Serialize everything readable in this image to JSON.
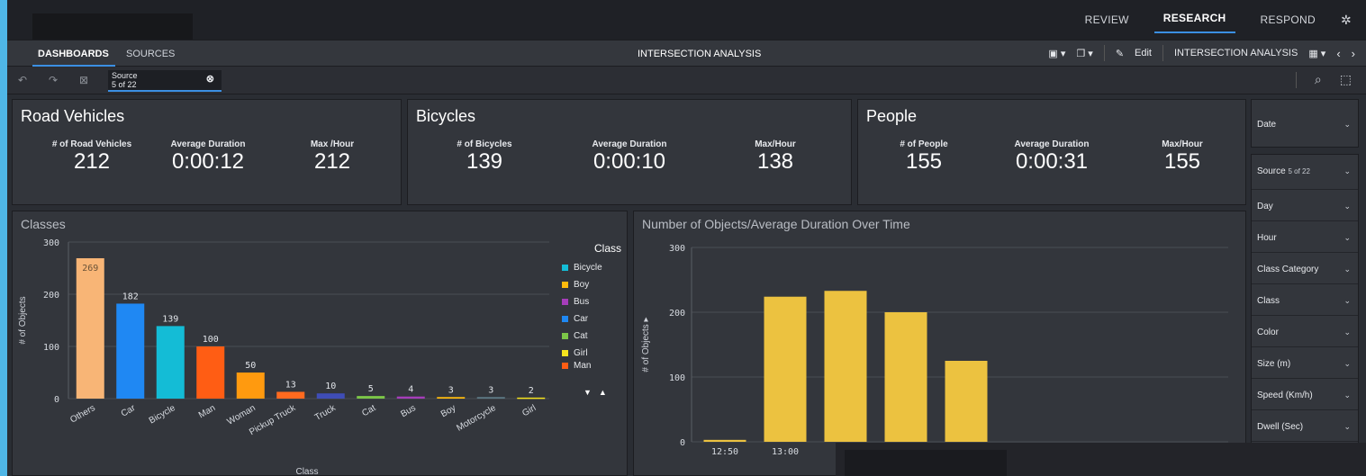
{
  "top_menu": {
    "review": "REVIEW",
    "research": "RESEARCH",
    "respond": "RESPOND",
    "gear_icon": "gear-icon"
  },
  "nav": {
    "dashboards": "DASHBOARDS",
    "sources": "SOURCES",
    "center_title": "INTERSECTION ANALYSIS",
    "edit": "Edit",
    "right_title": "INTERSECTION ANALYSIS"
  },
  "filter": {
    "source_label": "Source",
    "source_value": "5 of 22"
  },
  "kpis": [
    {
      "title": "Road Vehicles",
      "stats": [
        {
          "label": "# of Road Vehicles",
          "value": "212"
        },
        {
          "label": "Average Duration",
          "value": "0:00:12"
        },
        {
          "label": "Max /Hour",
          "value": "212"
        }
      ]
    },
    {
      "title": "Bicycles",
      "stats": [
        {
          "label": "# of Bicycles",
          "value": "139"
        },
        {
          "label": "Average Duration",
          "value": "0:00:10"
        },
        {
          "label": "Max/Hour",
          "value": "138"
        }
      ]
    },
    {
      "title": "People",
      "stats": [
        {
          "label": "# of People",
          "value": "155"
        },
        {
          "label": "Average Duration",
          "value": "0:00:31"
        },
        {
          "label": "Max/Hour",
          "value": "155"
        }
      ]
    }
  ],
  "chart_data": [
    {
      "type": "bar",
      "title": "Classes",
      "xlabel": "Class",
      "ylabel": "# of Objects",
      "ylim": [
        0,
        300
      ],
      "yticks": [
        "300",
        "200",
        "100",
        "0"
      ],
      "categories": [
        "Others",
        "Car",
        "Bicycle",
        "Man",
        "Woman",
        "Pickup Truck",
        "Truck",
        "Cat",
        "Bus",
        "Boy",
        "Motorcycle",
        "Girl"
      ],
      "values": [
        269,
        182,
        139,
        100,
        50,
        13,
        10,
        5,
        4,
        3,
        3,
        2
      ],
      "colors": [
        "#f8b576",
        "#1f88f3",
        "#14bcd6",
        "#ff5d14",
        "#ff9a0f",
        "#ff6a1f",
        "#3f4db6",
        "#7cc648",
        "#a63dba",
        "#ffbb0d",
        "#5d7a86",
        "#f6e41e"
      ],
      "legend_title": "Class",
      "legend": [
        {
          "name": "Bicycle",
          "color": "#14bcd6"
        },
        {
          "name": "Boy",
          "color": "#ffbb0d"
        },
        {
          "name": "Bus",
          "color": "#a63dba"
        },
        {
          "name": "Car",
          "color": "#1f88f3"
        },
        {
          "name": "Cat",
          "color": "#7cc648"
        },
        {
          "name": "Girl",
          "color": "#f6e41e"
        },
        {
          "name": "Man",
          "color": "#ff5d14"
        }
      ],
      "grid": true,
      "legend_position": "right"
    },
    {
      "type": "bar",
      "title": "Number of Objects/Average Duration Over Time",
      "ylabel": "# of Objects",
      "ylim": [
        0,
        300
      ],
      "yticks": [
        "300",
        "200",
        "100",
        "0"
      ],
      "categories": [
        "12:50",
        "13:00",
        "",
        "",
        ""
      ],
      "values": [
        3,
        224,
        233,
        200,
        125
      ],
      "color": "#ecc240",
      "grid": true
    }
  ],
  "filters": [
    {
      "label": "Date"
    },
    {
      "label": "Source",
      "sub": "5 of 22"
    },
    {
      "label": "Day"
    },
    {
      "label": "Hour"
    },
    {
      "label": "Class Category"
    },
    {
      "label": "Class"
    },
    {
      "label": "Color"
    },
    {
      "label": "Size (m)"
    },
    {
      "label": "Speed (Km/h)"
    },
    {
      "label": "Dwell (Sec)"
    }
  ]
}
